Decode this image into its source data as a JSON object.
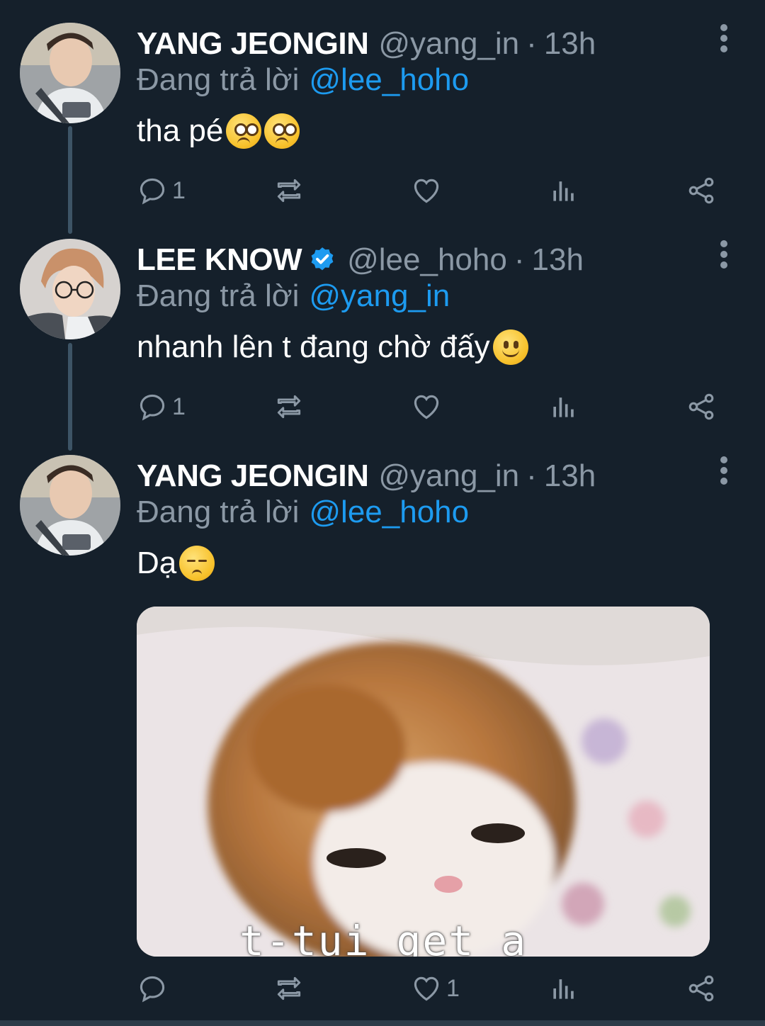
{
  "tweets": [
    {
      "name": "YANG JEONGIN",
      "handle": "@yang_in",
      "dot": "·",
      "time": "13h",
      "reply_prefix": "Đang trả lời",
      "reply_to": "@lee_hoho",
      "text": "tha pé",
      "emojis": [
        "pleading-face",
        "pleading-face"
      ],
      "replies": "1",
      "likes": ""
    },
    {
      "name": "LEE KNOW",
      "verified": true,
      "handle": "@lee_hoho",
      "dot": "·",
      "time": "13h",
      "reply_prefix": "Đang trả lời",
      "reply_to": "@yang_in",
      "text": "nhanh lên t đang chờ đấy",
      "emojis": [
        "slightly-smiling-face"
      ],
      "replies": "1",
      "likes": ""
    },
    {
      "name": "YANG JEONGIN",
      "handle": "@yang_in",
      "dot": "·",
      "time": "13h",
      "reply_prefix": "Đang trả lời",
      "reply_to": "@lee_hoho",
      "text": "Dạ",
      "emojis": [
        "pensive-face"
      ],
      "replies": "",
      "likes": "1",
      "media": {
        "caption": "t-tui get a",
        "kind": "kitten-photo"
      }
    }
  ],
  "colors": {
    "background": "#15202b",
    "accent": "#1d9bf0",
    "muted": "#8b98a5",
    "thread_line": "#3d5466"
  },
  "icons": [
    "reply-icon",
    "retweet-icon",
    "like-icon",
    "analytics-icon",
    "share-icon",
    "more-icon",
    "verified-badge-icon"
  ]
}
